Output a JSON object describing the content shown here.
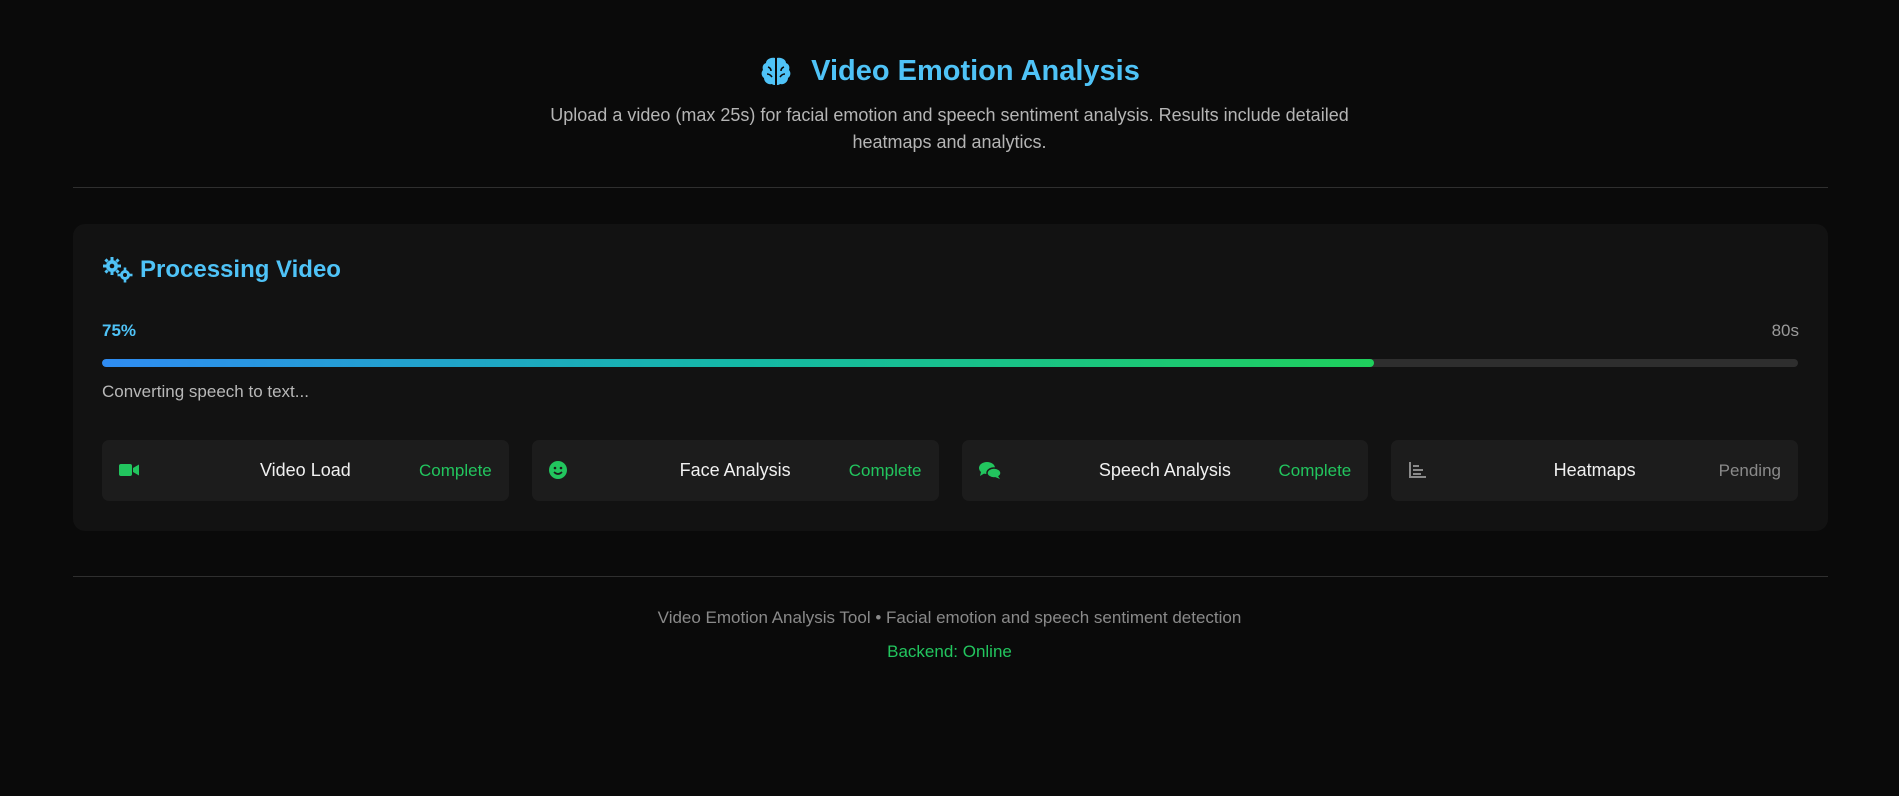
{
  "header": {
    "title": "Video Emotion Analysis",
    "subtitle": "Upload a video (max 25s) for facial emotion and speech sentiment analysis. Results include detailed heatmaps and analytics.",
    "icon": "brain-icon"
  },
  "processing": {
    "title": "Processing Video",
    "icon": "gears-icon",
    "percent_label": "75%",
    "progress": 0.75,
    "time_label": "80s",
    "status": "Converting speech to text..."
  },
  "steps": [
    {
      "name": "Video Load",
      "status": "Complete",
      "icon": "video-camera-icon",
      "color": "#22c55e"
    },
    {
      "name": "Face Analysis",
      "status": "Complete",
      "icon": "smiley-face-icon",
      "color": "#22c55e"
    },
    {
      "name": "Speech Analysis",
      "status": "Complete",
      "icon": "chat-bubbles-icon",
      "color": "#22c55e"
    },
    {
      "name": "Heatmaps",
      "status": "Pending",
      "icon": "bar-chart-icon",
      "color": "#8a8a8a"
    }
  ],
  "footer": {
    "text": "Video Emotion Analysis Tool • Facial emotion and speech sentiment detection",
    "backend": "Backend: Online"
  },
  "colors": {
    "accent": "#4fc3f7",
    "success": "#22c55e",
    "pending": "#8a8a8a"
  }
}
